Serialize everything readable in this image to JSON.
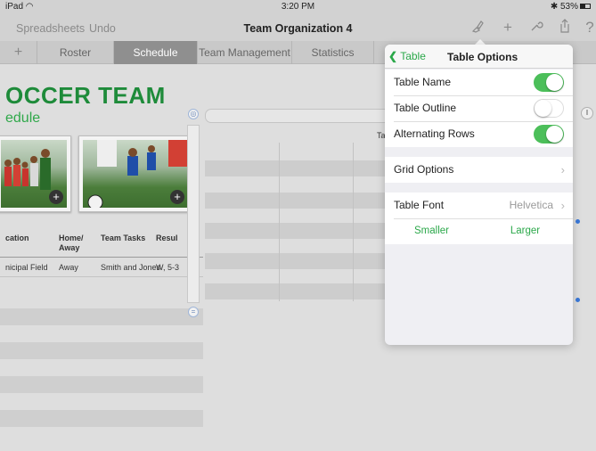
{
  "status_bar": {
    "device": "iPad",
    "wifi_icon": "wifi-icon",
    "time": "3:20 PM",
    "battery": "53%"
  },
  "nav": {
    "spreadsheets": "Spreadsheets",
    "undo": "Undo",
    "title": "Team Organization 4",
    "help": "?"
  },
  "tabs": [
    "Roster",
    "Schedule",
    "Team Management",
    "Statistics"
  ],
  "add_sheet_icon": "+",
  "sheet": {
    "title": "OCCER TEAM",
    "subtitle": "edule",
    "headers": {
      "location": "cation",
      "home_away": "Home/\nAway",
      "team_tasks": "Team Tasks",
      "result": "Resul"
    },
    "row1": {
      "location": "nicipal Field",
      "home_away": "Away",
      "team_tasks": "Smith and Jones",
      "result": "W, 5-3"
    },
    "partial_table_label": "Ta",
    "photo_plus": "+"
  },
  "popover": {
    "back_label": "Table",
    "title": "Table Options",
    "rows": {
      "table_name": {
        "label": "Table Name",
        "on": true
      },
      "table_outline": {
        "label": "Table Outline",
        "on": false
      },
      "alternating_rows": {
        "label": "Alternating Rows",
        "on": true
      },
      "grid_options": {
        "label": "Grid Options"
      },
      "table_font": {
        "label": "Table Font",
        "value": "Helvetica"
      }
    },
    "smaller": "Smaller",
    "larger": "Larger"
  },
  "colors": {
    "accent": "#2ba84a",
    "toggle_on": "#4cbf5a",
    "title_green": "#1e8b3a"
  }
}
